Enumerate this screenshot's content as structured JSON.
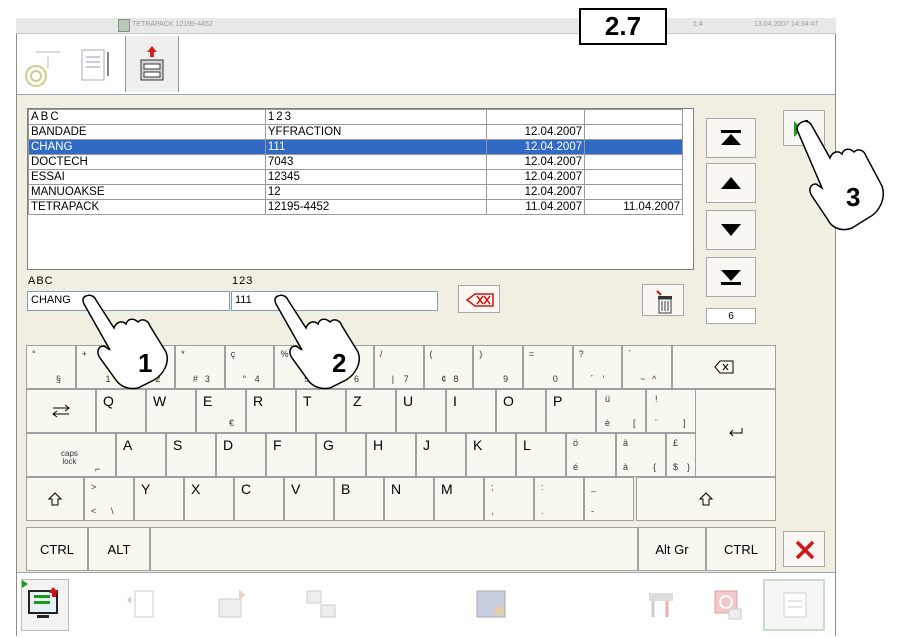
{
  "titlebar": {
    "title": "TETRAPACK 12195-4452",
    "page_fraction": "1:4",
    "datetime": "13.04.2007 14:34:47"
  },
  "page_number": "2.7",
  "list": {
    "headers": [
      "ABC",
      "123",
      "",
      ""
    ],
    "rows": [
      {
        "abc": "BANDADE",
        "num": "YFFRACTION",
        "d1": "12.04.2007",
        "d2": ""
      },
      {
        "abc": "CHANG",
        "num": "111",
        "d1": "12.04.2007",
        "d2": ""
      },
      {
        "abc": "DOCTECH",
        "num": "7043",
        "d1": "12.04.2007",
        "d2": ""
      },
      {
        "abc": "ESSAI",
        "num": "12345",
        "d1": "12.04.2007",
        "d2": ""
      },
      {
        "abc": "MANUOAKSE",
        "num": "12",
        "d1": "12.04.2007",
        "d2": ""
      },
      {
        "abc": "TETRAPACK",
        "num": "12195-4452",
        "d1": "11.04.2007",
        "d2": "11.04.2007"
      }
    ],
    "selected_index": 1
  },
  "fields": {
    "abc_label": "ABC",
    "num_label": "123",
    "abc_value": "CHANG",
    "num_value": "111"
  },
  "count": "6",
  "callouts": [
    "1",
    "2",
    "3"
  ],
  "keyboard": {
    "row1": [
      {
        "sh": "°",
        "m": "§"
      },
      {
        "sh": "+",
        "m": "1"
      },
      {
        "sh": "\"",
        "m": "2"
      },
      {
        "sh": "*",
        "m": "3"
      },
      {
        "sh": "ç",
        "m": "4"
      },
      {
        "sh": "%",
        "m": "5"
      },
      {
        "sh": "&",
        "m": "6"
      },
      {
        "sh": "/",
        "m": "7"
      },
      {
        "sh": "(",
        "m": "8"
      },
      {
        "sh": ")",
        "m": "9"
      },
      {
        "sh": "=",
        "m": "0"
      },
      {
        "sh": "?",
        "m": "'"
      },
      {
        "sh": "`",
        "m": "^"
      }
    ],
    "row1_alt": [
      "",
      "",
      "@",
      "#",
      "°",
      "",
      "",
      "|",
      "¢",
      "",
      "",
      "´",
      "~"
    ],
    "row2": [
      "Q",
      "W",
      "E",
      "R",
      "T",
      "Z",
      "U",
      "I",
      "O",
      "P"
    ],
    "row2_extra": [
      {
        "top": "ü",
        "bot": "è",
        "alt": "["
      },
      {
        "top": "!",
        "bot": "¨",
        "alt": "]"
      }
    ],
    "euro": "€",
    "row3": [
      "A",
      "S",
      "D",
      "F",
      "G",
      "H",
      "J",
      "K",
      "L"
    ],
    "row3_extra": [
      {
        "top": "ö",
        "bot": "é",
        "alt": ""
      },
      {
        "top": "ä",
        "bot": "à",
        "alt": "{"
      },
      {
        "top": "£",
        "bot": "$",
        "alt": "}"
      }
    ],
    "caps_label": "caps\nlock",
    "row4": [
      {
        "top": ">",
        "bot": "<",
        "alt": "\\"
      },
      {
        "m": "Y"
      },
      {
        "m": "X"
      },
      {
        "m": "C"
      },
      {
        "m": "V"
      },
      {
        "m": "B"
      },
      {
        "m": "N"
      },
      {
        "m": "M"
      }
    ],
    "row4_extra": [
      {
        "top": ";",
        "bot": ","
      },
      {
        "top": ":",
        "bot": "."
      },
      {
        "top": "_",
        "bot": "-"
      }
    ],
    "ctrl_label": "CTRL",
    "alt_label": "ALT",
    "altgr_label": "Alt Gr",
    "ctrl2_label": "CTRL"
  },
  "colors": {
    "selection": "#316ac5",
    "panel": "#f1efe2",
    "cancel_red": "#d11515",
    "ok_green": "#1a9c1a"
  }
}
